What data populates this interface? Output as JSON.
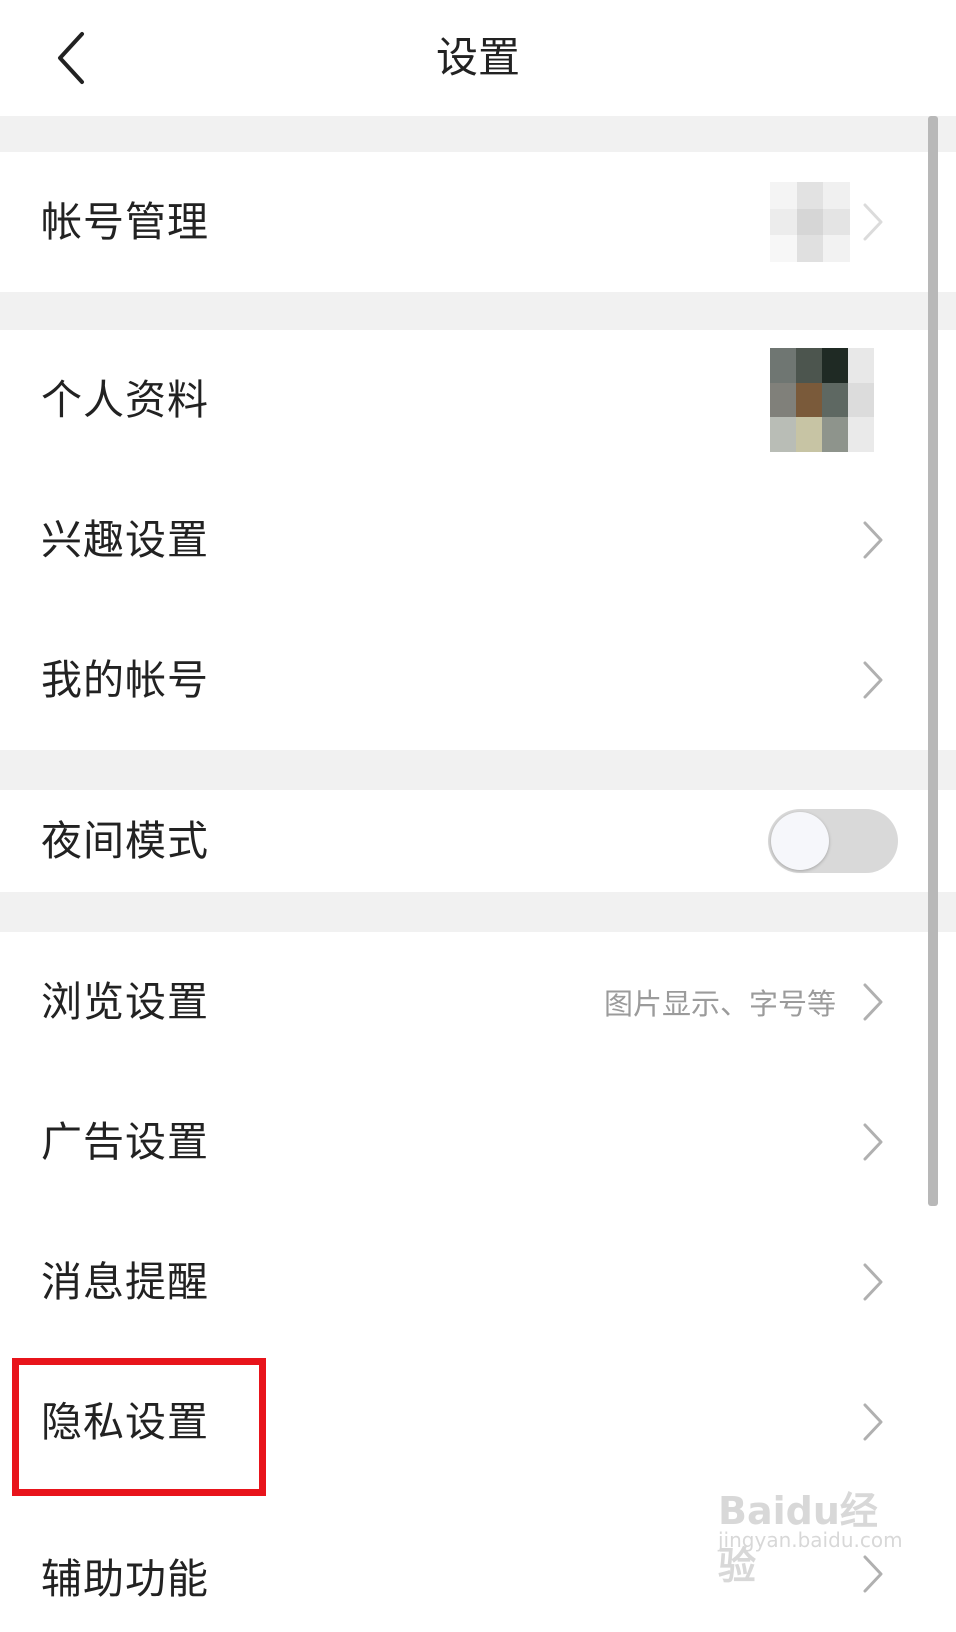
{
  "header": {
    "title": "设置"
  },
  "rows": {
    "account_mgmt": {
      "label": "帐号管理"
    },
    "profile": {
      "label": "个人资料"
    },
    "interest": {
      "label": "兴趣设置"
    },
    "my_account": {
      "label": "我的帐号"
    },
    "night_mode": {
      "label": "夜间模式",
      "enabled": false
    },
    "browse": {
      "label": "浏览设置",
      "hint": "图片显示、字号等"
    },
    "ads": {
      "label": "广告设置"
    },
    "notifications": {
      "label": "消息提醒"
    },
    "privacy": {
      "label": "隐私设置"
    },
    "accessibility": {
      "label": "辅助功能"
    }
  },
  "colors": {
    "background": "#ffffff",
    "separator": "#f1f1f1",
    "highlight": "#e8141b",
    "toggle_off": "#d9d9d9"
  },
  "icons": [
    "back-icon",
    "chevron-right-icon"
  ],
  "watermark": {
    "logo": "Baidu经验",
    "url": "jingyan.baidu.com"
  }
}
